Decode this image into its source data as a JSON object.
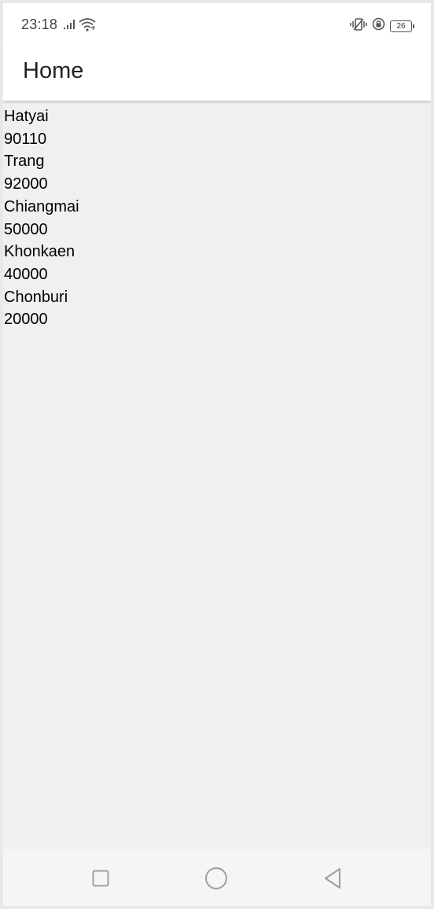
{
  "status_bar": {
    "time": "23:18",
    "battery_level": "26",
    "left_icons": [
      "signal-icon",
      "wifi-icon"
    ],
    "right_icons": [
      "vibrate-icon",
      "rotation-lock-icon",
      "battery-icon"
    ]
  },
  "app_bar": {
    "title": "Home"
  },
  "list": {
    "lines": [
      "Hatyai",
      "90110",
      "Trang",
      "92000",
      "Chiangmai",
      "50000",
      "Khonkaen",
      "40000",
      "Chonburi",
      "20000"
    ]
  },
  "nav_bar": {
    "buttons": [
      "recents-square-icon",
      "home-circle-icon",
      "back-triangle-icon"
    ]
  },
  "colors": {
    "background": "#f0f0f0",
    "app_bar": "#ffffff",
    "nav_bar": "#f5f5f5",
    "icon_gray": "#9e9e9e"
  }
}
